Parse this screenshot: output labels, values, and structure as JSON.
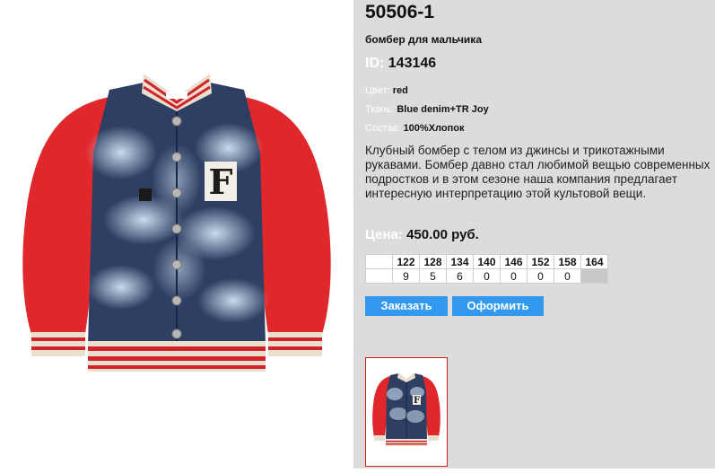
{
  "product": {
    "code": "50506-1",
    "subtitle": "бомбер для мальчика",
    "id_label": "ID:",
    "id_value": "143146",
    "color_label": "Цвет:",
    "color_value": "red",
    "fabric_label": "Ткань:",
    "fabric_value": "Blue denim+TR Joy",
    "composition_label": "Состав:",
    "composition_value": "100%Хлопок",
    "description": "Клубный бомбер с телом из джинсы и трикотажными рукавами. Бомбер давно стал любимой вещью современных подростков и в этом сезоне наша компания предлагает интересную интерпретацию этой культовой вещи.",
    "price_label": "Цена:",
    "price_value": "450.00 руб."
  },
  "sizes": {
    "headers": [
      "122",
      "128",
      "134",
      "140",
      "146",
      "152",
      "158",
      "164"
    ],
    "quantities": [
      "9",
      "5",
      "6",
      "0",
      "0",
      "0",
      "0",
      ""
    ]
  },
  "actions": {
    "order_label": "Заказать",
    "checkout_label": "Оформить"
  },
  "photo": {
    "badge_letter": "F",
    "thumb_badge_letter": "F"
  },
  "colors": {
    "accent": "#3399ee",
    "sleeve": "#e0282c",
    "denim": "#2e3f63",
    "label_text": "#ffffff",
    "panel_bg": "#dcdcdc"
  }
}
